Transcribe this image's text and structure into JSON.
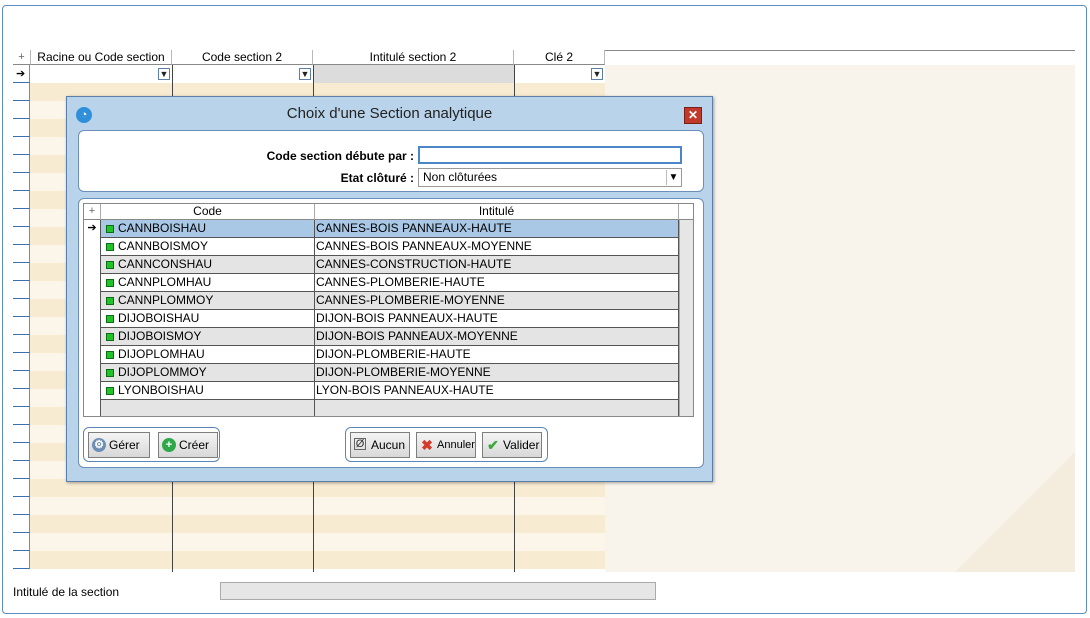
{
  "grid": {
    "columns": [
      {
        "label": "Racine ou Code section"
      },
      {
        "label": "Code section 2"
      },
      {
        "label": "Intitulé section 2"
      },
      {
        "label": "Clé 2"
      }
    ],
    "add_icon": "+",
    "row_pointer": "➔"
  },
  "bottom": {
    "intitule_label": "Intitulé de la section",
    "intitule_value": ""
  },
  "dialog": {
    "title": "Choix d'une Section analytique",
    "close": "✕",
    "code_label": "Code section débute par :",
    "code_value": "",
    "etat_label": "Etat clôturé :",
    "etat_value": "Non clôturées",
    "list": {
      "col_code": "Code",
      "col_intitule": "Intitulé",
      "rows": [
        {
          "code": "CANNBOISHAU",
          "intitule": "CANNES-BOIS PANNEAUX-HAUTE"
        },
        {
          "code": "CANNBOISMOY",
          "intitule": "CANNES-BOIS PANNEAUX-MOYENNE"
        },
        {
          "code": "CANNCONSHAU",
          "intitule": "CANNES-CONSTRUCTION-HAUTE"
        },
        {
          "code": "CANNPLOMHAU",
          "intitule": "CANNES-PLOMBERIE-HAUTE"
        },
        {
          "code": "CANNPLOMMOY",
          "intitule": "CANNES-PLOMBERIE-MOYENNE"
        },
        {
          "code": "DIJOBOISHAU",
          "intitule": "DIJON-BOIS PANNEAUX-HAUTE"
        },
        {
          "code": "DIJOBOISMOY",
          "intitule": "DIJON-BOIS PANNEAUX-MOYENNE"
        },
        {
          "code": "DIJOPLOMHAU",
          "intitule": "DIJON-PLOMBERIE-HAUTE"
        },
        {
          "code": "DIJOPLOMMOY",
          "intitule": "DIJON-PLOMBERIE-MOYENNE"
        },
        {
          "code": "LYONBOISHAU",
          "intitule": "LYON-BOIS PANNEAUX-HAUTE"
        }
      ]
    },
    "buttons": {
      "gerer": "Gérer",
      "creer": "Créer",
      "aucun": "Aucun",
      "annuler": "Annuler",
      "valider": "Valider"
    }
  }
}
